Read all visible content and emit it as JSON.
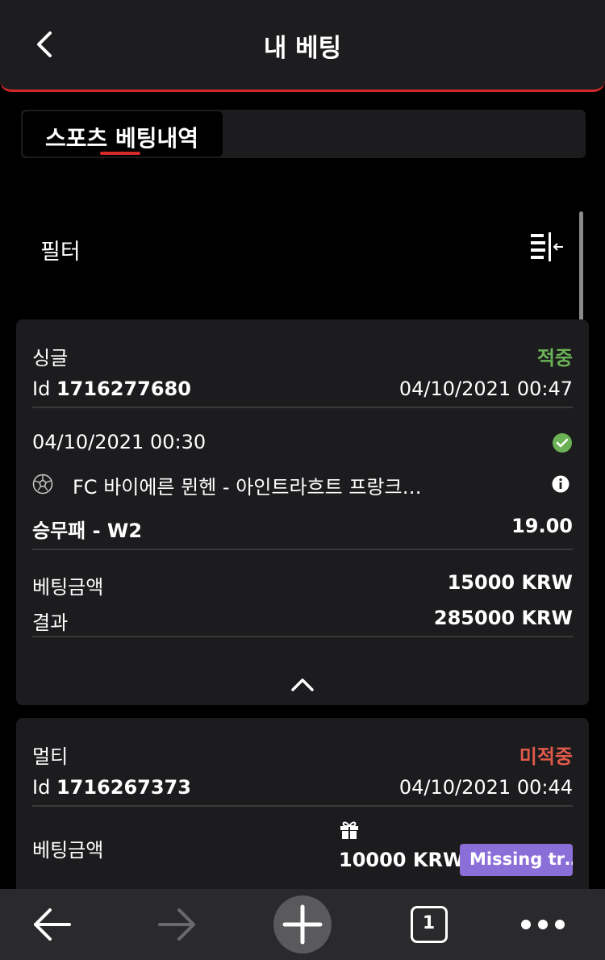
{
  "header": {
    "title": "내 베팅"
  },
  "tabs": [
    {
      "label": "스포츠 베팅내역"
    }
  ],
  "filter": {
    "label": "필터"
  },
  "bets": [
    {
      "type": "싱글",
      "status": "적중",
      "id_label": "Id",
      "id": "1716277680",
      "placed_at": "04/10/2021 00:47",
      "event": {
        "datetime": "04/10/2021 00:30",
        "match": "FC 바이에른 뮌헨 - 아인트라흐트 프랑크…",
        "market": "승무패 - W2",
        "odds": "19.00"
      },
      "stake_label": "베팅금액",
      "stake": "15000 KRW",
      "result_label": "결과",
      "result": "285000 KRW"
    },
    {
      "type": "멀티",
      "status": "미적중",
      "id_label": "Id",
      "id": "1716267373",
      "placed_at": "04/10/2021 00:44",
      "stake_label": "베팅금액",
      "stake": "10000 KRW",
      "badge": "Missing tr…"
    }
  ],
  "bottom_nav": {
    "tab_count": "1"
  },
  "colors": {
    "accent": "#d62a2a",
    "win": "#6bb257",
    "loss": "#e05a4a",
    "badge": "#8b6fd8"
  }
}
